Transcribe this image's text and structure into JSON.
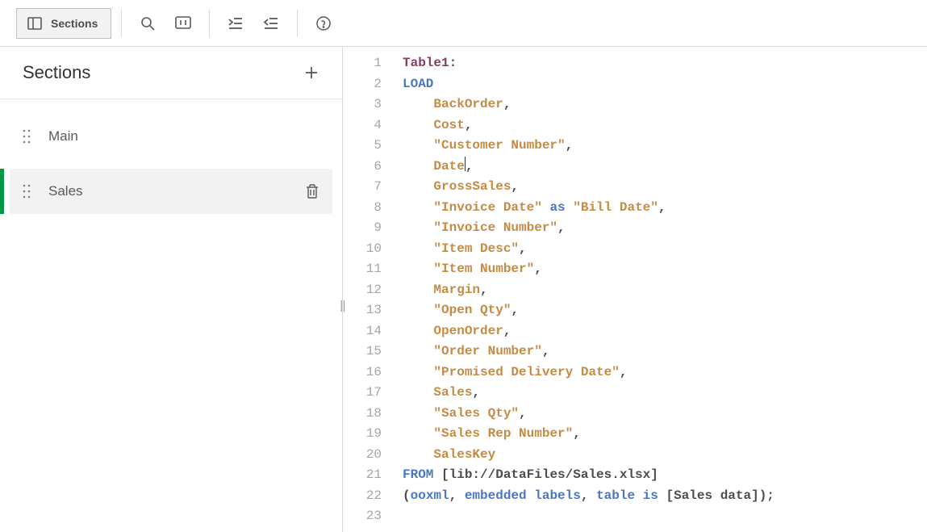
{
  "toolbar": {
    "sections_button_label": "Sections"
  },
  "sidebar": {
    "title": "Sections",
    "items": [
      {
        "name": "Main",
        "active": false
      },
      {
        "name": "Sales",
        "active": true
      }
    ]
  },
  "editor": {
    "line_numbers": [
      "1",
      "2",
      "3",
      "4",
      "5",
      "6",
      "7",
      "8",
      "9",
      "10",
      "11",
      "12",
      "13",
      "14",
      "15",
      "16",
      "17",
      "18",
      "19",
      "20",
      "21",
      "22",
      "23"
    ],
    "lines": [
      {
        "tokens": [
          {
            "text": "Table1",
            "cls": "tk-table"
          },
          {
            "text": ":",
            "cls": "tk-punct"
          }
        ]
      },
      {
        "tokens": [
          {
            "text": "LOAD",
            "cls": "tk-keyword"
          }
        ]
      },
      {
        "indent": "    ",
        "tokens": [
          {
            "text": "BackOrder",
            "cls": "tk-field"
          },
          {
            "text": ",",
            "cls": "tk-punct"
          }
        ]
      },
      {
        "indent": "    ",
        "tokens": [
          {
            "text": "Cost",
            "cls": "tk-field"
          },
          {
            "text": ",",
            "cls": "tk-punct"
          }
        ]
      },
      {
        "indent": "    ",
        "tokens": [
          {
            "text": "\"Customer Number\"",
            "cls": "tk-field"
          },
          {
            "text": ",",
            "cls": "tk-punct"
          }
        ]
      },
      {
        "indent": "    ",
        "tokens": [
          {
            "text": "Date",
            "cls": "tk-field"
          },
          {
            "caret": true
          },
          {
            "text": ",",
            "cls": "tk-punct"
          }
        ]
      },
      {
        "indent": "    ",
        "tokens": [
          {
            "text": "GrossSales",
            "cls": "tk-field"
          },
          {
            "text": ",",
            "cls": "tk-punct"
          }
        ]
      },
      {
        "indent": "    ",
        "tokens": [
          {
            "text": "\"Invoice Date\"",
            "cls": "tk-field"
          },
          {
            "text": " ",
            "cls": ""
          },
          {
            "text": "as",
            "cls": "tk-keyword"
          },
          {
            "text": " ",
            "cls": ""
          },
          {
            "text": "\"Bill Date\"",
            "cls": "tk-field"
          },
          {
            "text": ",",
            "cls": "tk-punct"
          }
        ]
      },
      {
        "indent": "    ",
        "tokens": [
          {
            "text": "\"Invoice Number\"",
            "cls": "tk-field"
          },
          {
            "text": ",",
            "cls": "tk-punct"
          }
        ]
      },
      {
        "indent": "    ",
        "tokens": [
          {
            "text": "\"Item Desc\"",
            "cls": "tk-field"
          },
          {
            "text": ",",
            "cls": "tk-punct"
          }
        ]
      },
      {
        "indent": "    ",
        "tokens": [
          {
            "text": "\"Item Number\"",
            "cls": "tk-field"
          },
          {
            "text": ",",
            "cls": "tk-punct"
          }
        ]
      },
      {
        "indent": "    ",
        "tokens": [
          {
            "text": "Margin",
            "cls": "tk-field"
          },
          {
            "text": ",",
            "cls": "tk-punct"
          }
        ]
      },
      {
        "indent": "    ",
        "tokens": [
          {
            "text": "\"Open Qty\"",
            "cls": "tk-field"
          },
          {
            "text": ",",
            "cls": "tk-punct"
          }
        ]
      },
      {
        "indent": "    ",
        "tokens": [
          {
            "text": "OpenOrder",
            "cls": "tk-field"
          },
          {
            "text": ",",
            "cls": "tk-punct"
          }
        ]
      },
      {
        "indent": "    ",
        "tokens": [
          {
            "text": "\"Order Number\"",
            "cls": "tk-field"
          },
          {
            "text": ",",
            "cls": "tk-punct"
          }
        ]
      },
      {
        "indent": "    ",
        "tokens": [
          {
            "text": "\"Promised Delivery Date\"",
            "cls": "tk-field"
          },
          {
            "text": ",",
            "cls": "tk-punct"
          }
        ]
      },
      {
        "indent": "    ",
        "tokens": [
          {
            "text": "Sales",
            "cls": "tk-field"
          },
          {
            "text": ",",
            "cls": "tk-punct"
          }
        ]
      },
      {
        "indent": "    ",
        "tokens": [
          {
            "text": "\"Sales Qty\"",
            "cls": "tk-field"
          },
          {
            "text": ",",
            "cls": "tk-punct"
          }
        ]
      },
      {
        "indent": "    ",
        "tokens": [
          {
            "text": "\"Sales Rep Number\"",
            "cls": "tk-field"
          },
          {
            "text": ",",
            "cls": "tk-punct"
          }
        ]
      },
      {
        "indent": "    ",
        "tokens": [
          {
            "text": "SalesKey",
            "cls": "tk-field"
          }
        ]
      },
      {
        "tokens": [
          {
            "text": "FROM",
            "cls": "tk-keyword"
          },
          {
            "text": " ",
            "cls": ""
          },
          {
            "text": "[lib://DataFiles/Sales.xlsx]",
            "cls": "tk-path"
          }
        ]
      },
      {
        "tokens": [
          {
            "text": "(",
            "cls": "tk-punct"
          },
          {
            "text": "ooxml",
            "cls": "tk-keyword"
          },
          {
            "text": ", ",
            "cls": "tk-punct"
          },
          {
            "text": "embedded labels",
            "cls": "tk-keyword"
          },
          {
            "text": ", ",
            "cls": "tk-punct"
          },
          {
            "text": "table is",
            "cls": "tk-keyword"
          },
          {
            "text": " ",
            "cls": ""
          },
          {
            "text": "[Sales data]",
            "cls": "tk-path"
          },
          {
            "text": ");",
            "cls": "tk-punct"
          }
        ]
      },
      {
        "tokens": []
      }
    ]
  }
}
